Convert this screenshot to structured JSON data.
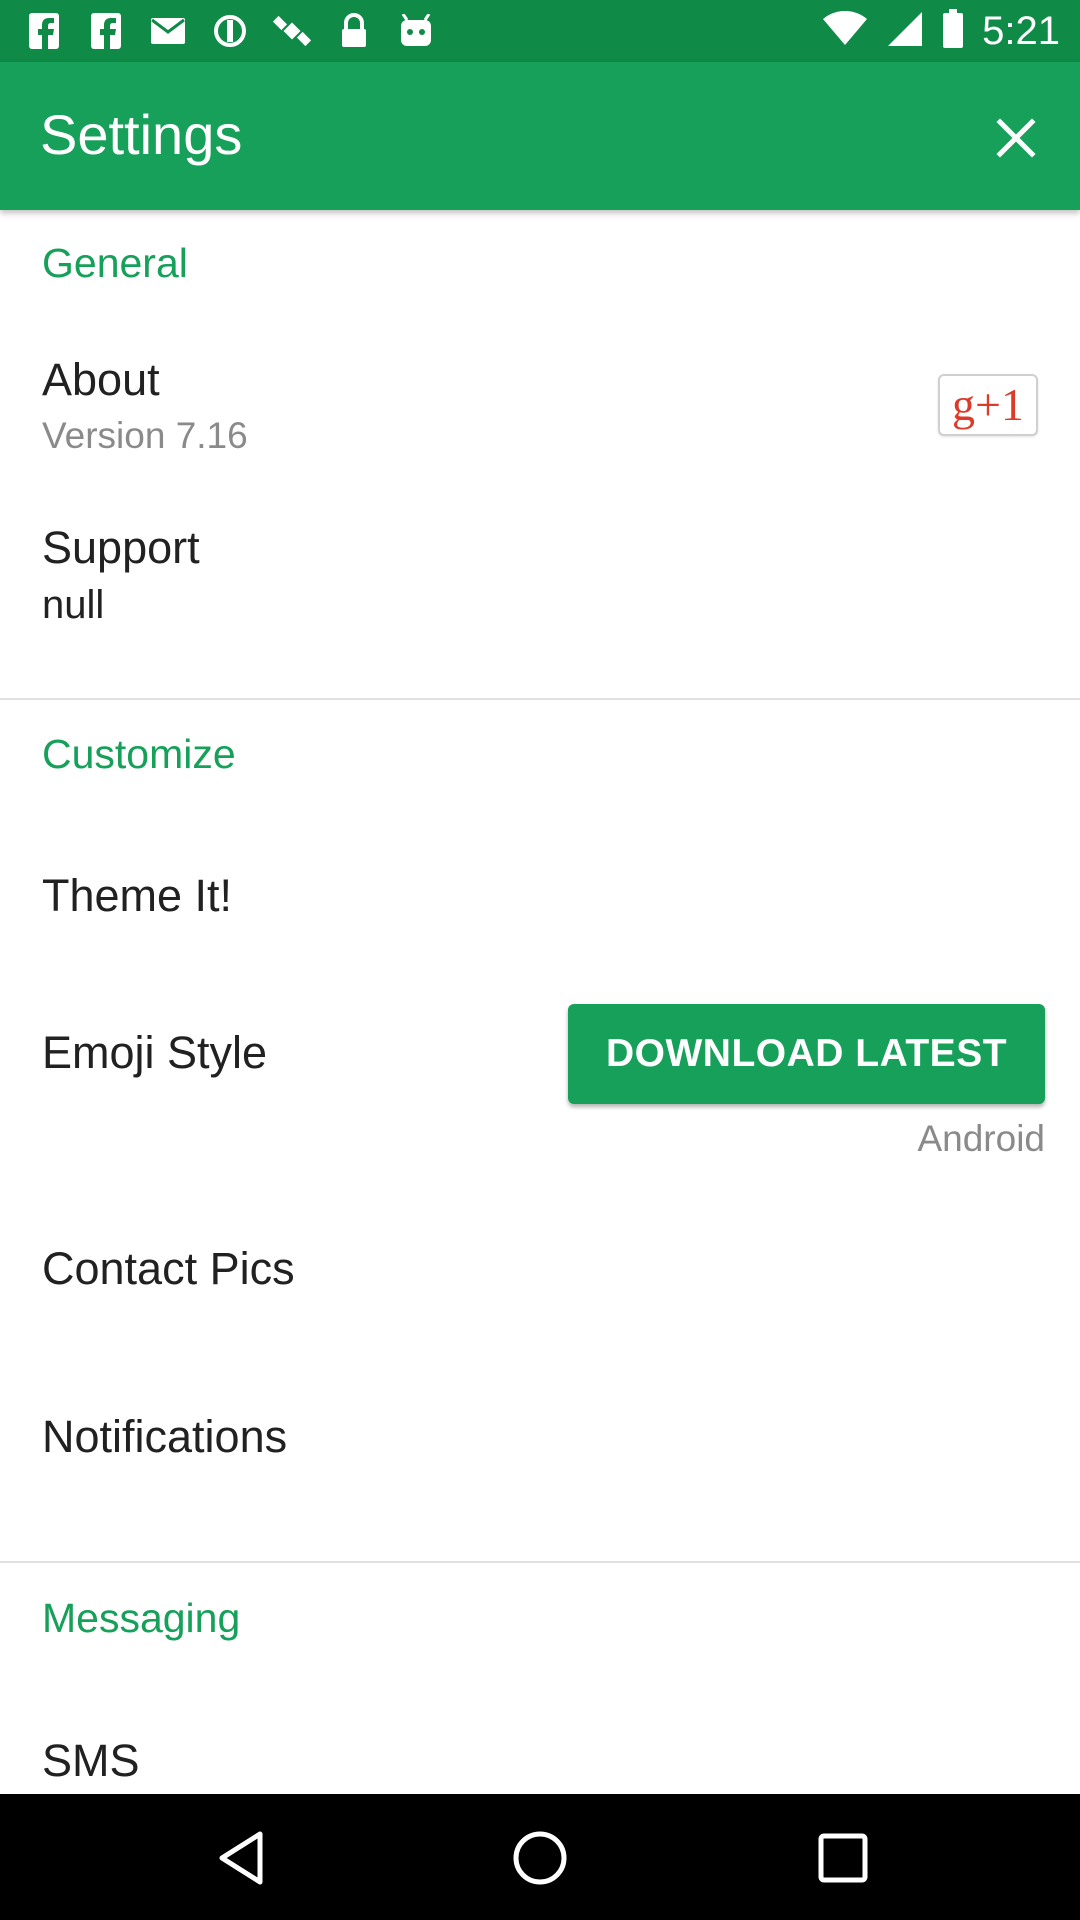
{
  "status_bar": {
    "time": "5:21",
    "icons": [
      "facebook-icon",
      "facebook-icon",
      "mail-icon",
      "sync-icon",
      "satellite-icon",
      "lock-icon",
      "android-icon",
      "wifi-icon",
      "signal-icon",
      "battery-icon"
    ]
  },
  "app_bar": {
    "title": "Settings",
    "close_icon": "close-icon"
  },
  "sections": {
    "general": {
      "header": "General",
      "about": {
        "title": "About",
        "summary": "Version 7.16",
        "badge": "g+1"
      },
      "support": {
        "title": "Support",
        "summary": "null"
      }
    },
    "customize": {
      "header": "Customize",
      "theme": {
        "title": "Theme It!"
      },
      "emoji": {
        "title": "Emoji Style",
        "button": "DOWNLOAD LATEST",
        "summary": "Android"
      },
      "contact_pics": {
        "title": "Contact Pics"
      },
      "notifications": {
        "title": "Notifications"
      }
    },
    "messaging": {
      "header": "Messaging",
      "sms": {
        "title": "SMS"
      }
    }
  },
  "nav_bar": {
    "back": "back-icon",
    "home": "home-icon",
    "recents": "recents-icon"
  },
  "colors": {
    "accent": "#16a05a",
    "status_bar": "#0f8a47",
    "gplus_red": "#dd3b2a"
  }
}
